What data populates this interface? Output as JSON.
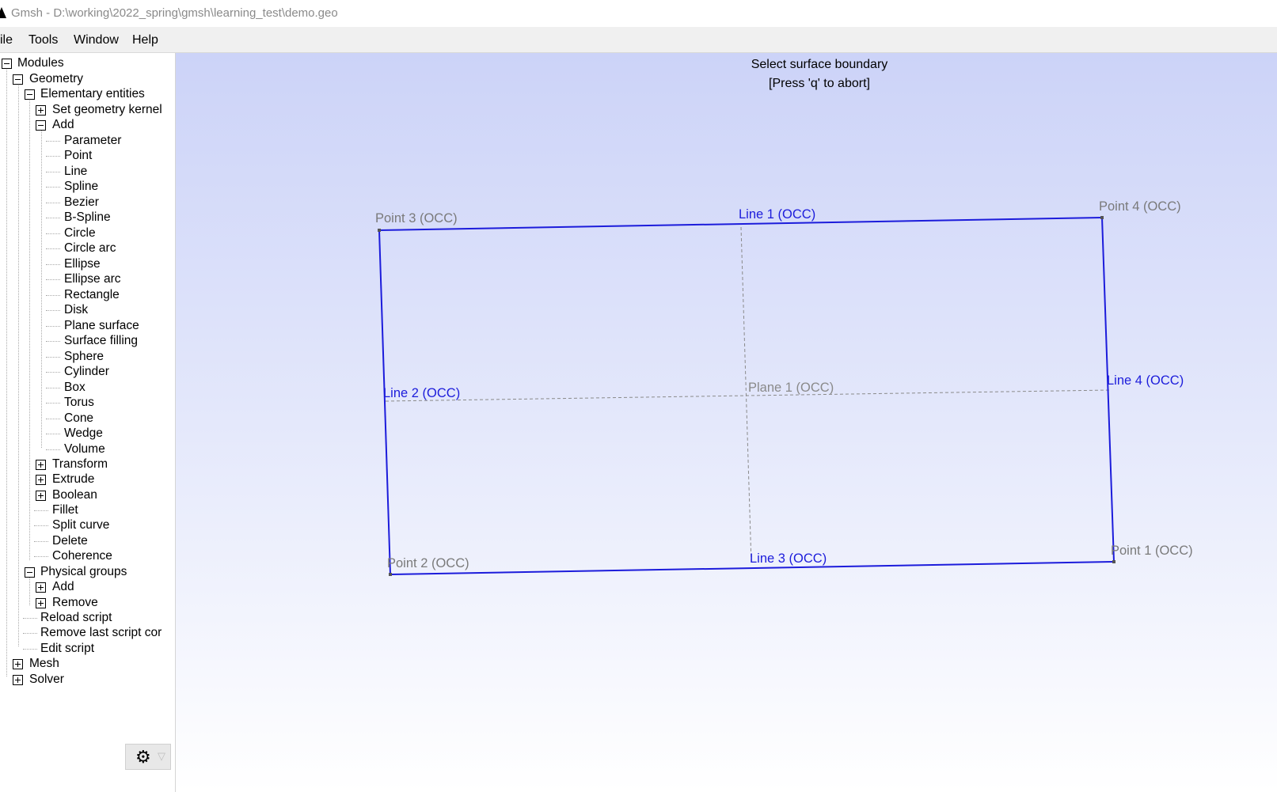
{
  "window": {
    "title": "Gmsh - D:\\working\\2022_spring\\gmsh\\learning_test\\demo.geo"
  },
  "menubar": {
    "items": [
      "ile",
      "Tools",
      "Window",
      "Help"
    ]
  },
  "tree": {
    "modules": "Modules",
    "geometry": "Geometry",
    "elementary": "Elementary entities",
    "set_kernel": "Set geometry kernel",
    "add": "Add",
    "add_items": [
      "Parameter",
      "Point",
      "Line",
      "Spline",
      "Bezier",
      "B-Spline",
      "Circle",
      "Circle arc",
      "Ellipse",
      "Ellipse arc",
      "Rectangle",
      "Disk",
      "Plane surface",
      "Surface filling",
      "Sphere",
      "Cylinder",
      "Box",
      "Torus",
      "Cone",
      "Wedge",
      "Volume"
    ],
    "transform": "Transform",
    "extrude": "Extrude",
    "boolean": "Boolean",
    "fillet": "Fillet",
    "split_curve": "Split curve",
    "delete": "Delete",
    "coherence": "Coherence",
    "physical_groups": "Physical groups",
    "pg_add": "Add",
    "pg_remove": "Remove",
    "reload_script": "Reload script",
    "remove_last": "Remove last script cor",
    "edit_script": "Edit script",
    "mesh": "Mesh",
    "solver": "Solver"
  },
  "toolbar": {
    "gear_icon": "gear-icon",
    "dropdown_icon": "dropdown-arrow-icon"
  },
  "viewport": {
    "status_line1": "Select surface boundary",
    "status_line2": "[Press 'q' to abort]",
    "labels": {
      "point1": "Point 1 (OCC)",
      "point2": "Point 2 (OCC)",
      "point3": "Point 3 (OCC)",
      "point4": "Point 4 (OCC)",
      "line1": "Line 1 (OCC)",
      "line2": "Line 2 (OCC)",
      "line3": "Line 3 (OCC)",
      "line4": "Line 4 (OCC)",
      "plane": "Plane 1 (OCC)"
    },
    "colors": {
      "line": "#1c1cdb",
      "point_label": "#7a7a7a",
      "axis": "#8a8a8a",
      "background_top": "#ccd3f8",
      "background_bottom": "#ffffff"
    }
  }
}
